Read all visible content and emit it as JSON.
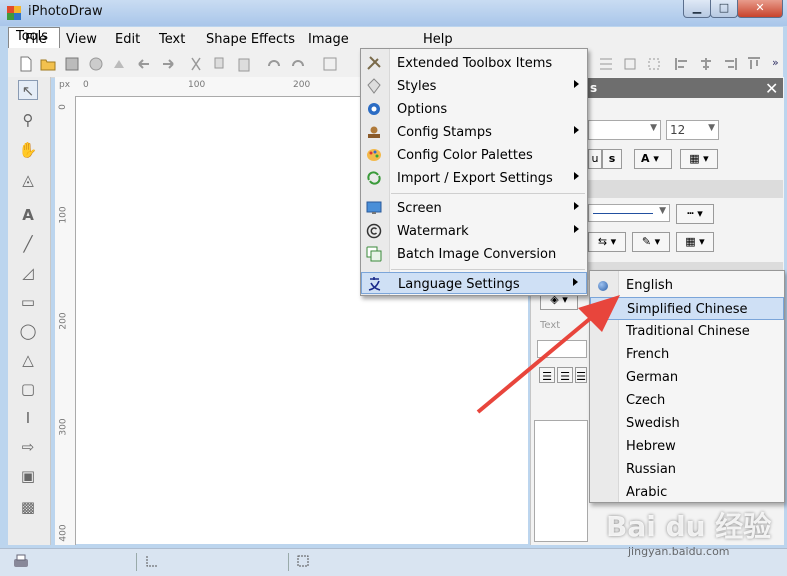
{
  "window": {
    "title": "iPhotoDraw",
    "min_label": "▁",
    "max_label": "□",
    "close_label": "✕"
  },
  "menubar": {
    "items": [
      "File",
      "View",
      "Edit",
      "Text",
      "Shape Effects",
      "Image",
      "Tools",
      "Help"
    ]
  },
  "ruler": {
    "unit": "px",
    "top_labels": [
      "0",
      "100",
      "200"
    ],
    "left_labels": [
      "0",
      "100",
      "200",
      "300",
      "400"
    ]
  },
  "panel": {
    "title_partial": "s",
    "font_size": "12",
    "text_label": "Text",
    "bold_label": "u",
    "strike_label": "s",
    "font_color_label": "A"
  },
  "tools_menu": {
    "items": [
      {
        "label": "Extended Toolbox Items",
        "icon": "tools-icon",
        "submenu": false
      },
      {
        "label": "Styles",
        "icon": "styles-icon",
        "submenu": true
      },
      {
        "label": "Options",
        "icon": "gear-icon",
        "submenu": false
      },
      {
        "label": "Config Stamps",
        "icon": "stamp-icon",
        "submenu": true
      },
      {
        "label": "Config Color Palettes",
        "icon": "palette-icon",
        "submenu": false
      },
      {
        "label": "Import / Export Settings",
        "icon": "import-export-icon",
        "submenu": true
      },
      {
        "label": "Screen",
        "icon": "screen-icon",
        "submenu": true
      },
      {
        "label": "Watermark",
        "icon": "copyright-icon",
        "submenu": true
      },
      {
        "label": "Batch Image Conversion",
        "icon": "batch-convert-icon",
        "submenu": false
      },
      {
        "label": "Language Settings",
        "icon": "language-icon",
        "submenu": true
      }
    ]
  },
  "language_menu": {
    "items": [
      "English",
      "Simplified Chinese",
      "Traditional Chinese",
      "French",
      "German",
      "Czech",
      "Swedish",
      "Hebrew",
      "Russian",
      "Arabic"
    ],
    "selected": "English",
    "highlighted": "Simplified Chinese"
  },
  "watermark": {
    "logo_text": "Bai du 经验",
    "url": "jingyan.baidu.com"
  },
  "colors": {
    "accent_highlight": "#cfe0f5",
    "arrow": "#e8453c",
    "title_bar": "#b9d0ee"
  }
}
